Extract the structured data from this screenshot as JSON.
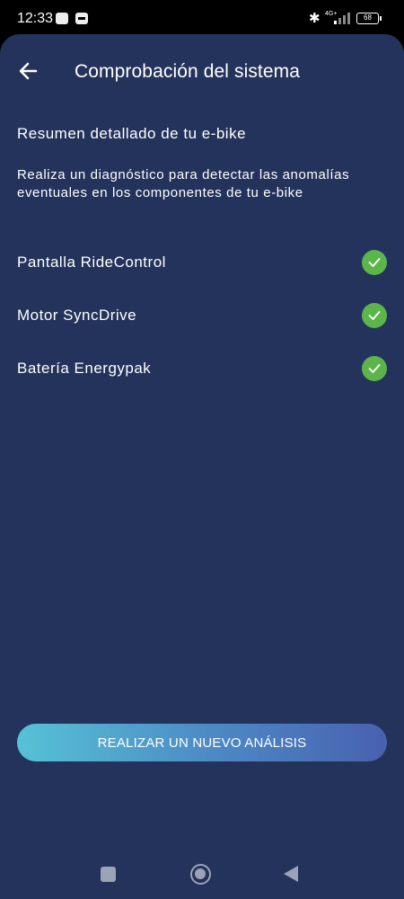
{
  "status_bar": {
    "time": "12:33",
    "network": "4G+",
    "battery": "68"
  },
  "header": {
    "title": "Comprobación del sistema"
  },
  "summary": {
    "subtitle": "Resumen detallado de tu e-bike",
    "description": "Realiza un diagnóstico para detectar las anomalías eventuales en los componentes de tu e-bike"
  },
  "components": [
    {
      "label": "Pantalla RideControl",
      "status": "ok"
    },
    {
      "label": "Motor SyncDrive",
      "status": "ok"
    },
    {
      "label": "Batería Energypak",
      "status": "ok"
    }
  ],
  "actions": {
    "analyze_label": "REALIZAR UN NUEVO ANÁLISIS"
  },
  "colors": {
    "background": "#24335b",
    "check_ok": "#5cb54a",
    "button_gradient_start": "#56c2d6",
    "button_gradient_end": "#4861b0"
  },
  "icons": {
    "back": "arrow-left-icon",
    "check": "check-circle-icon"
  }
}
